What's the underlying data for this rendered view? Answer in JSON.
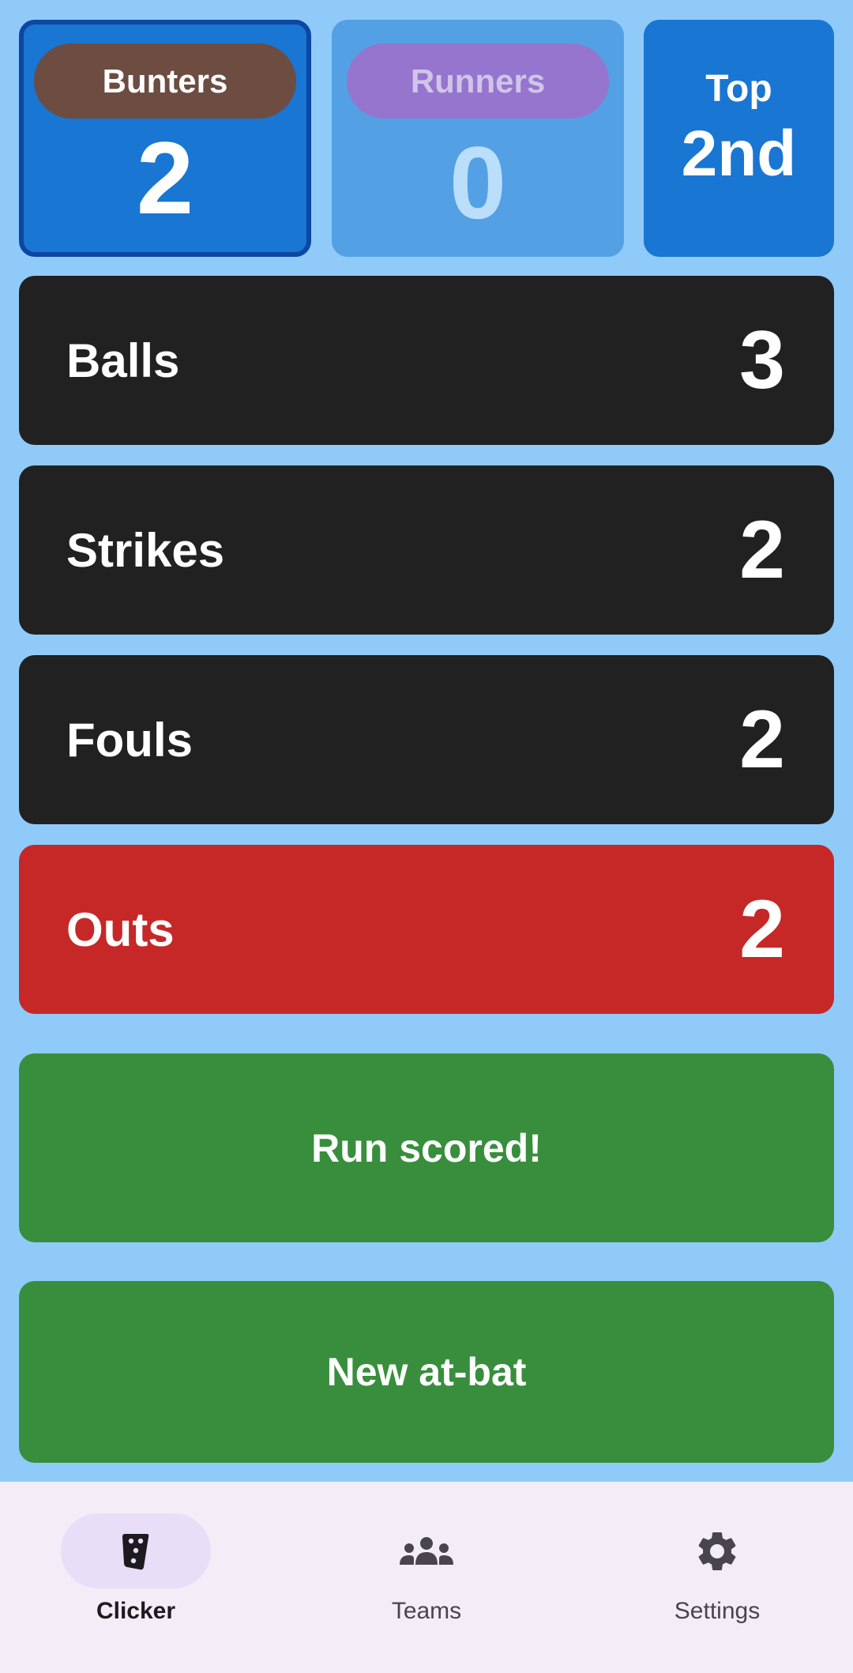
{
  "scoreboard": {
    "home": {
      "name": "Bunters",
      "score": "2"
    },
    "away": {
      "name": "Runners",
      "score": "0"
    },
    "inning": {
      "half": "Top",
      "number": "2nd"
    }
  },
  "counts": [
    {
      "label": "Balls",
      "value": "3"
    },
    {
      "label": "Strikes",
      "value": "2"
    },
    {
      "label": "Fouls",
      "value": "2"
    },
    {
      "label": "Outs",
      "value": "2"
    }
  ],
  "actions": {
    "run_scored": "Run scored!",
    "new_at_bat": "New at-bat"
  },
  "nav": {
    "items": [
      {
        "label": "Clicker",
        "icon": "clicker-icon",
        "active": true
      },
      {
        "label": "Teams",
        "icon": "groups-icon",
        "active": false
      },
      {
        "label": "Settings",
        "icon": "gear-icon",
        "active": false
      }
    ]
  },
  "colors": {
    "background": "#90caf9",
    "home_card": "#1976d2",
    "home_pill": "#6d4c41",
    "away_card": "#54a0e5",
    "away_pill": "#9575cd",
    "count_row": "#212121",
    "outs_row": "#c62828",
    "action_button": "#388e3c",
    "nav_background": "#f3edf7",
    "nav_indicator": "#e8def8"
  }
}
